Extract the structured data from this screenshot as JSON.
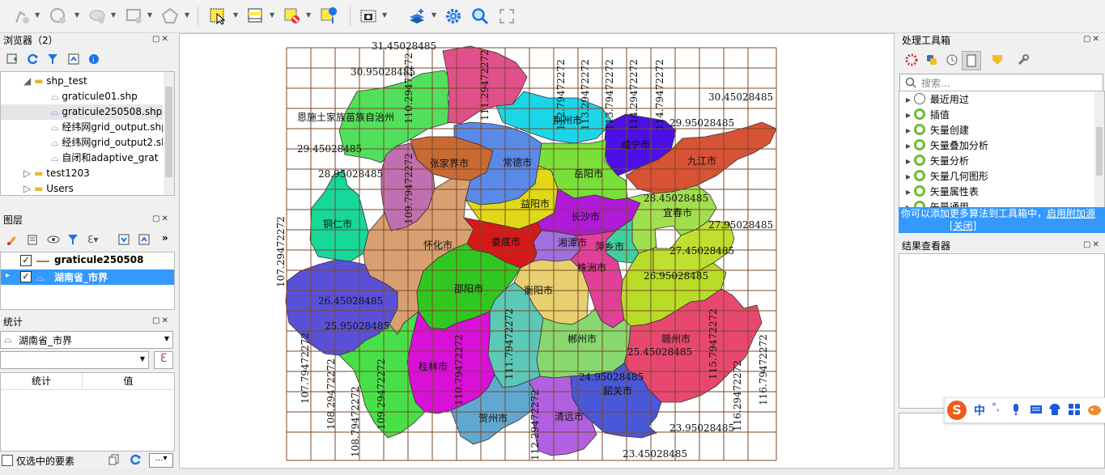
{
  "browser": {
    "title": "浏览器（2）",
    "items": [
      {
        "label": "shp_test"
      },
      {
        "label": "graticule01.shp"
      },
      {
        "label": "graticule250508.shp"
      },
      {
        "label": "经纬网grid_output.shp"
      },
      {
        "label": "经纬网grid_output2.shp"
      },
      {
        "label": "自闭和adaptive_grat"
      },
      {
        "label": "test1203"
      },
      {
        "label": "Users"
      }
    ]
  },
  "layers": {
    "title": "图层",
    "items": [
      {
        "label": "graticule250508",
        "checked": true
      },
      {
        "label": "湖南省_市界",
        "checked": true
      }
    ]
  },
  "stats": {
    "title": "统计",
    "layer_select": "湖南省_市界",
    "col_stat": "统计",
    "col_value": "值",
    "selected_only": "仅选中的要素"
  },
  "processing": {
    "title": "处理工具箱",
    "search_placeholder": "搜索…",
    "items": [
      {
        "label": "最近用过",
        "icon": "clock-icon"
      },
      {
        "label": "插值",
        "icon": "qgis-icon"
      },
      {
        "label": "矢量创建",
        "icon": "qgis-icon"
      },
      {
        "label": "矢量叠加分析",
        "icon": "qgis-icon"
      },
      {
        "label": "矢量分析",
        "icon": "qgis-icon"
      },
      {
        "label": "矢量几何图形",
        "icon": "qgis-icon"
      },
      {
        "label": "矢量属性表",
        "icon": "qgis-icon"
      },
      {
        "label": "矢量通用",
        "icon": "qgis-icon"
      }
    ],
    "notice_text": "你可以添加更多算法到工具箱中，",
    "notice_link1": "启用附加源",
    "notice_link2": "[关闭]"
  },
  "results": {
    "title": "结果查看器"
  },
  "ime": {
    "label": "中"
  },
  "map": {
    "lat_labels": [
      {
        "text": "31.45028485"
      },
      {
        "text": "30.95028485"
      },
      {
        "text": "30.45028485"
      },
      {
        "text": "29.95028485"
      },
      {
        "text": "29.45028485"
      },
      {
        "text": "28.95028485"
      },
      {
        "text": "28.45028485"
      },
      {
        "text": "27.95028485"
      },
      {
        "text": "27.45028485"
      },
      {
        "text": "26.95028485"
      },
      {
        "text": "26.45028485"
      },
      {
        "text": "25.95028485"
      },
      {
        "text": "25.45028485"
      },
      {
        "text": "24.95028485"
      },
      {
        "text": "23.95028485"
      },
      {
        "text": "23.45028485"
      }
    ],
    "lon_labels": [
      {
        "text": "107.29472272"
      },
      {
        "text": "107.79472272"
      },
      {
        "text": "108.29472272"
      },
      {
        "text": "108.79472272"
      },
      {
        "text": "109.29472272"
      },
      {
        "text": "109.79472272"
      },
      {
        "text": "110.29472272"
      },
      {
        "text": "110.79472272"
      },
      {
        "text": "111.29472272"
      },
      {
        "text": "111.79472272"
      },
      {
        "text": "112.29472272"
      },
      {
        "text": "112.79472272"
      },
      {
        "text": "113.29472272"
      },
      {
        "text": "113.79472272"
      },
      {
        "text": "114.29472272"
      },
      {
        "text": "114.79472272"
      },
      {
        "text": "115.79472272"
      },
      {
        "text": "116.29472272"
      },
      {
        "text": "116.79472272"
      }
    ],
    "regions": [
      {
        "name": "恩施土家族苗族自治州",
        "color": "#52e05c"
      },
      {
        "name": "荆州市",
        "color": "#1ad6e8"
      },
      {
        "name": "咸宁市",
        "color": "#4a10e6"
      },
      {
        "name": "九江市",
        "color": "#d85236"
      },
      {
        "name": "张家界市",
        "color": "#c96a32"
      },
      {
        "name": "常德市",
        "color": "#5a8ae8"
      },
      {
        "name": "岳阳市",
        "color": "#78e038"
      },
      {
        "name": "益阳市",
        "color": "#e0d818"
      },
      {
        "name": "长沙市",
        "color": "#b01ad8"
      },
      {
        "name": "宜春市",
        "color": "#a0e050"
      },
      {
        "name": "铜仁市",
        "color": "#16d89a"
      },
      {
        "name": "怀化市",
        "color": "#d8a070"
      },
      {
        "name": "娄底市",
        "color": "#d81818"
      },
      {
        "name": "湘潭市",
        "color": "#a070e0"
      },
      {
        "name": "萍乡市",
        "color": "#40d0a0"
      },
      {
        "name": "株洲市",
        "color": "#e04098"
      },
      {
        "name": "邵阳市",
        "color": "#30c820"
      },
      {
        "name": "衡阳市",
        "color": "#e8d070"
      },
      {
        "name": "郴州市",
        "color": "#88d870"
      },
      {
        "name": "赣州市",
        "color": "#e84870"
      },
      {
        "name": "桂林市",
        "color": "#d810d8"
      },
      {
        "name": "贺州市",
        "color": "#60a8d0"
      },
      {
        "name": "清远市",
        "color": "#b060e0"
      },
      {
        "name": "韶关市",
        "color": "#4858d8"
      }
    ]
  }
}
